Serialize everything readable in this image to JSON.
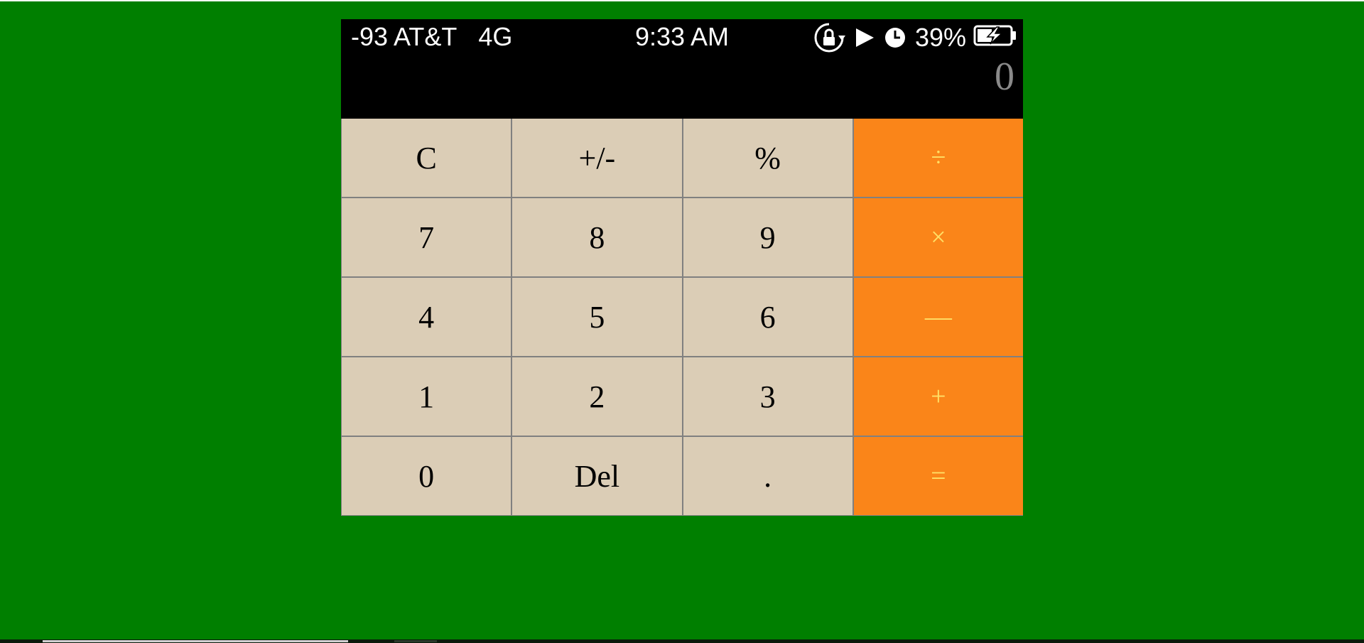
{
  "status_bar": {
    "signal": "-93",
    "carrier": "AT&T",
    "network": "4G",
    "time": "9:33 AM",
    "battery_percent": "39%",
    "icons": [
      "rotation-lock-icon",
      "play-icon",
      "alarm-icon",
      "battery-charging-icon"
    ]
  },
  "display": {
    "value": "0"
  },
  "keypad": {
    "rows": [
      [
        {
          "label": "C",
          "type": "function"
        },
        {
          "label": "+/-",
          "type": "function"
        },
        {
          "label": "%",
          "type": "function"
        },
        {
          "label": "÷",
          "type": "operator"
        }
      ],
      [
        {
          "label": "7",
          "type": "digit"
        },
        {
          "label": "8",
          "type": "digit"
        },
        {
          "label": "9",
          "type": "digit"
        },
        {
          "label": "×",
          "type": "operator"
        }
      ],
      [
        {
          "label": "4",
          "type": "digit"
        },
        {
          "label": "5",
          "type": "digit"
        },
        {
          "label": "6",
          "type": "digit"
        },
        {
          "label": "—",
          "type": "operator"
        }
      ],
      [
        {
          "label": "1",
          "type": "digit"
        },
        {
          "label": "2",
          "type": "digit"
        },
        {
          "label": "3",
          "type": "digit"
        },
        {
          "label": "+",
          "type": "operator"
        }
      ],
      [
        {
          "label": "0",
          "type": "digit"
        },
        {
          "label": "Del",
          "type": "function"
        },
        {
          "label": ".",
          "type": "digit"
        },
        {
          "label": "=",
          "type": "operator"
        }
      ]
    ]
  },
  "colors": {
    "page_background": "#007f00",
    "header_background": "#000000",
    "key_background": "#dbcdb6",
    "operator_background": "#fa8519",
    "operator_text": "#ffe066",
    "display_text": "#8a8a8a"
  }
}
